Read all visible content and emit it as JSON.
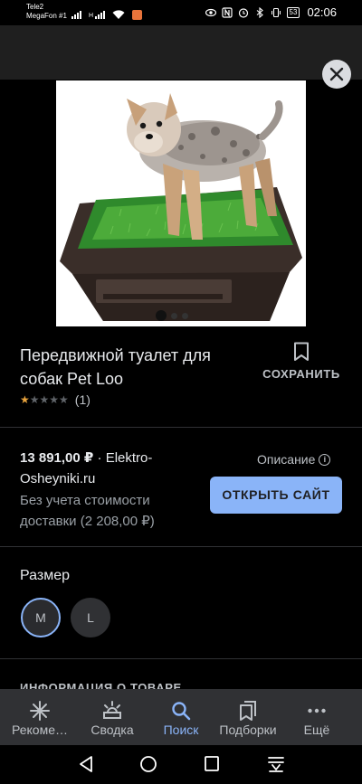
{
  "status_bar": {
    "carrier1": "Tele2",
    "carrier2": "MegaFon #1",
    "network_type": "H",
    "battery": "53",
    "time": "02:06"
  },
  "top_bar": {
    "close_icon": "close-icon"
  },
  "product": {
    "image_icon": "product-photo",
    "carousel_count": 3,
    "carousel_active": 1,
    "title": "Передвижной туалет для собак Pet Loo",
    "save_label": "СОХРАНИТЬ",
    "rating_stars": 1,
    "rating_max": 5,
    "rating_count": "(1)"
  },
  "offer": {
    "price": "13 891,00 ₽",
    "separator": " · ",
    "seller": "Elektro-Osheyniki.ru",
    "shipping": "Без учета стоимости доставки (2 208,00 ₽)",
    "description_label": "Описание",
    "open_site_label": "ОТКРЫТЬ САЙТ"
  },
  "size": {
    "title": "Размер",
    "options": [
      "M",
      "L"
    ],
    "selected": "M"
  },
  "info_heading": "ИНФОРМАЦИЯ О ТОВАРЕ",
  "bottom_nav": [
    {
      "label": "Рекоме…",
      "icon": "asterisk-icon"
    },
    {
      "label": "Сводка",
      "icon": "updates-icon"
    },
    {
      "label": "Поиск",
      "icon": "search-icon",
      "active": true
    },
    {
      "label": "Подборки",
      "icon": "collections-icon"
    },
    {
      "label": "Ещё",
      "icon": "more-icon"
    }
  ],
  "colors": {
    "accent": "#8ab4f8",
    "background": "#000000",
    "nav_background": "#303134",
    "star": "#e8a33d"
  }
}
